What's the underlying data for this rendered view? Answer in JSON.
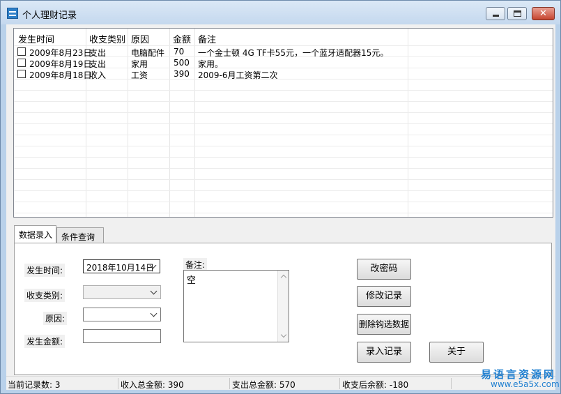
{
  "window": {
    "title": "个人理财记录"
  },
  "table": {
    "columns": [
      "发生时间",
      "收支类别",
      "原因",
      "金额",
      "备注"
    ],
    "rows": [
      {
        "date": "2009年8月23日",
        "type": "支出",
        "reason": "电脑配件",
        "amount": "70",
        "note": "一个金士顿 4G TF卡55元，一个蓝牙适配器15元。",
        "checked": false
      },
      {
        "date": "2009年8月19日",
        "type": "支出",
        "reason": "家用",
        "amount": "500",
        "note": "家用。",
        "checked": false
      },
      {
        "date": "2009年8月18日",
        "type": "收入",
        "reason": "工资",
        "amount": "390",
        "note": "2009-6月工资第二次",
        "checked": false
      }
    ]
  },
  "tabs": [
    {
      "label": "数据录入",
      "active": true
    },
    {
      "label": "条件查询",
      "active": false
    }
  ],
  "form": {
    "date_label": "发生时间:",
    "date_value": "2018年10月14日",
    "type_label": "收支类别:",
    "type_value": "",
    "reason_label": "原因:",
    "reason_value": "",
    "amount_label": "发生金额:",
    "amount_value": "",
    "note_label": "备注:",
    "note_value": "空"
  },
  "buttons": {
    "change_password": "改密码",
    "modify_record": "修改记录",
    "delete_checked": "删除钩选数据",
    "add_record": "录入记录",
    "about": "关于"
  },
  "statusbar": {
    "record_count": "当前记录数: 3",
    "income_total": "收入总金额: 390",
    "expense_total": "支出总金额: 570",
    "balance": "收支后余额: -180"
  },
  "watermark": {
    "name": "易语言资源网",
    "url": "www.e5a5x.com"
  },
  "colors": {
    "frame": "#b9d1ea",
    "watermark": "#1f7fd0",
    "close_button": "#c6452f"
  }
}
